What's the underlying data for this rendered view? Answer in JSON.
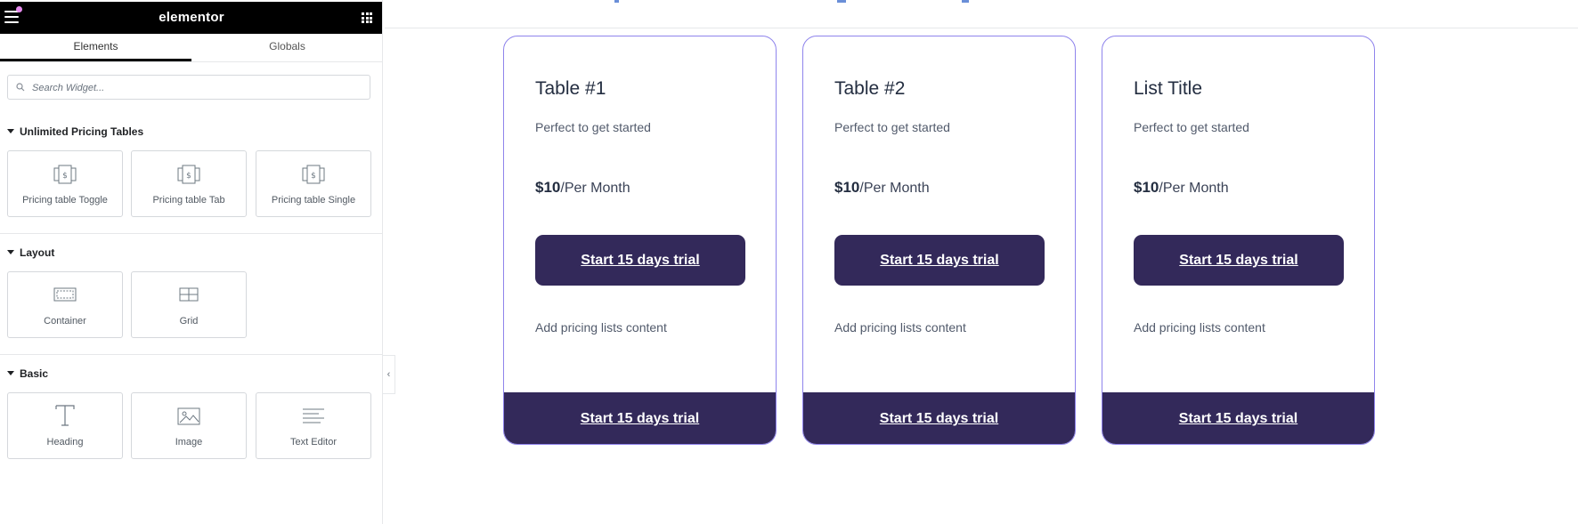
{
  "editor": {
    "logo": "elementor",
    "tabs": [
      {
        "label": "Elements",
        "active": true
      },
      {
        "label": "Globals",
        "active": false
      }
    ],
    "search": {
      "placeholder": "Search Widget..."
    },
    "categories": [
      {
        "name": "Unlimited Pricing Tables",
        "widgets": [
          {
            "label": "Pricing table Toggle",
            "icon": "pricing-table-icon"
          },
          {
            "label": "Pricing table Tab",
            "icon": "pricing-table-icon"
          },
          {
            "label": "Pricing table Single",
            "icon": "pricing-table-icon"
          }
        ]
      },
      {
        "name": "Layout",
        "widgets": [
          {
            "label": "Container",
            "icon": "container-icon"
          },
          {
            "label": "Grid",
            "icon": "grid-icon"
          }
        ]
      },
      {
        "name": "Basic",
        "widgets": [
          {
            "label": "Heading",
            "icon": "heading-icon"
          },
          {
            "label": "Image",
            "icon": "image-icon"
          },
          {
            "label": "Text Editor",
            "icon": "text-editor-icon"
          }
        ]
      }
    ],
    "collapse_glyph": "‹"
  },
  "cards": [
    {
      "title": "Table #1",
      "subtitle": "Perfect to get started",
      "amount": "$10",
      "period": "/Per Month",
      "button": "Start 15 days trial",
      "lists": "Add pricing lists content",
      "footer_button": "Start 15 days trial"
    },
    {
      "title": "Table #2",
      "subtitle": "Perfect to get started",
      "amount": "$10",
      "period": "/Per Month",
      "button": "Start 15 days trial",
      "lists": "Add pricing lists content",
      "footer_button": "Start 15 days trial"
    },
    {
      "title": "List Title",
      "subtitle": "Perfect to get started",
      "amount": "$10",
      "period": "/Per Month",
      "button": "Start 15 days trial",
      "lists": "Add pricing lists content",
      "footer_button": "Start 15 days trial"
    }
  ],
  "colors": {
    "topbar": "#000000",
    "card_border": "#8f84ec",
    "button_bg": "#33295a",
    "heading_text": "#232d40"
  }
}
